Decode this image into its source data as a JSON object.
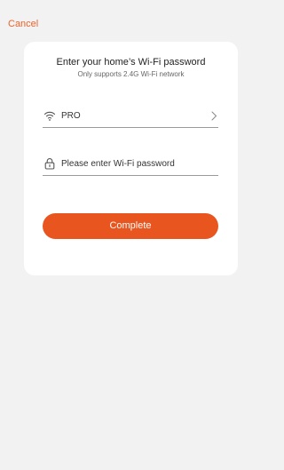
{
  "header": {
    "cancel_label": "Cancel"
  },
  "card": {
    "title": "Enter your home’s Wi-Fi password",
    "subtitle": "Only supports 2.4G Wi-Fi network",
    "ssid": {
      "icon": "wifi-icon",
      "value": "PRO",
      "chevron_icon": "chevron-right-icon"
    },
    "password": {
      "icon": "lock-icon",
      "value": "",
      "placeholder": "Please enter Wi-Fi password"
    },
    "submit_label": "Complete"
  },
  "colors": {
    "accent": "#e8551f",
    "cancel_text": "#e8642c",
    "background": "#f2f2f2",
    "card": "#ffffff"
  }
}
